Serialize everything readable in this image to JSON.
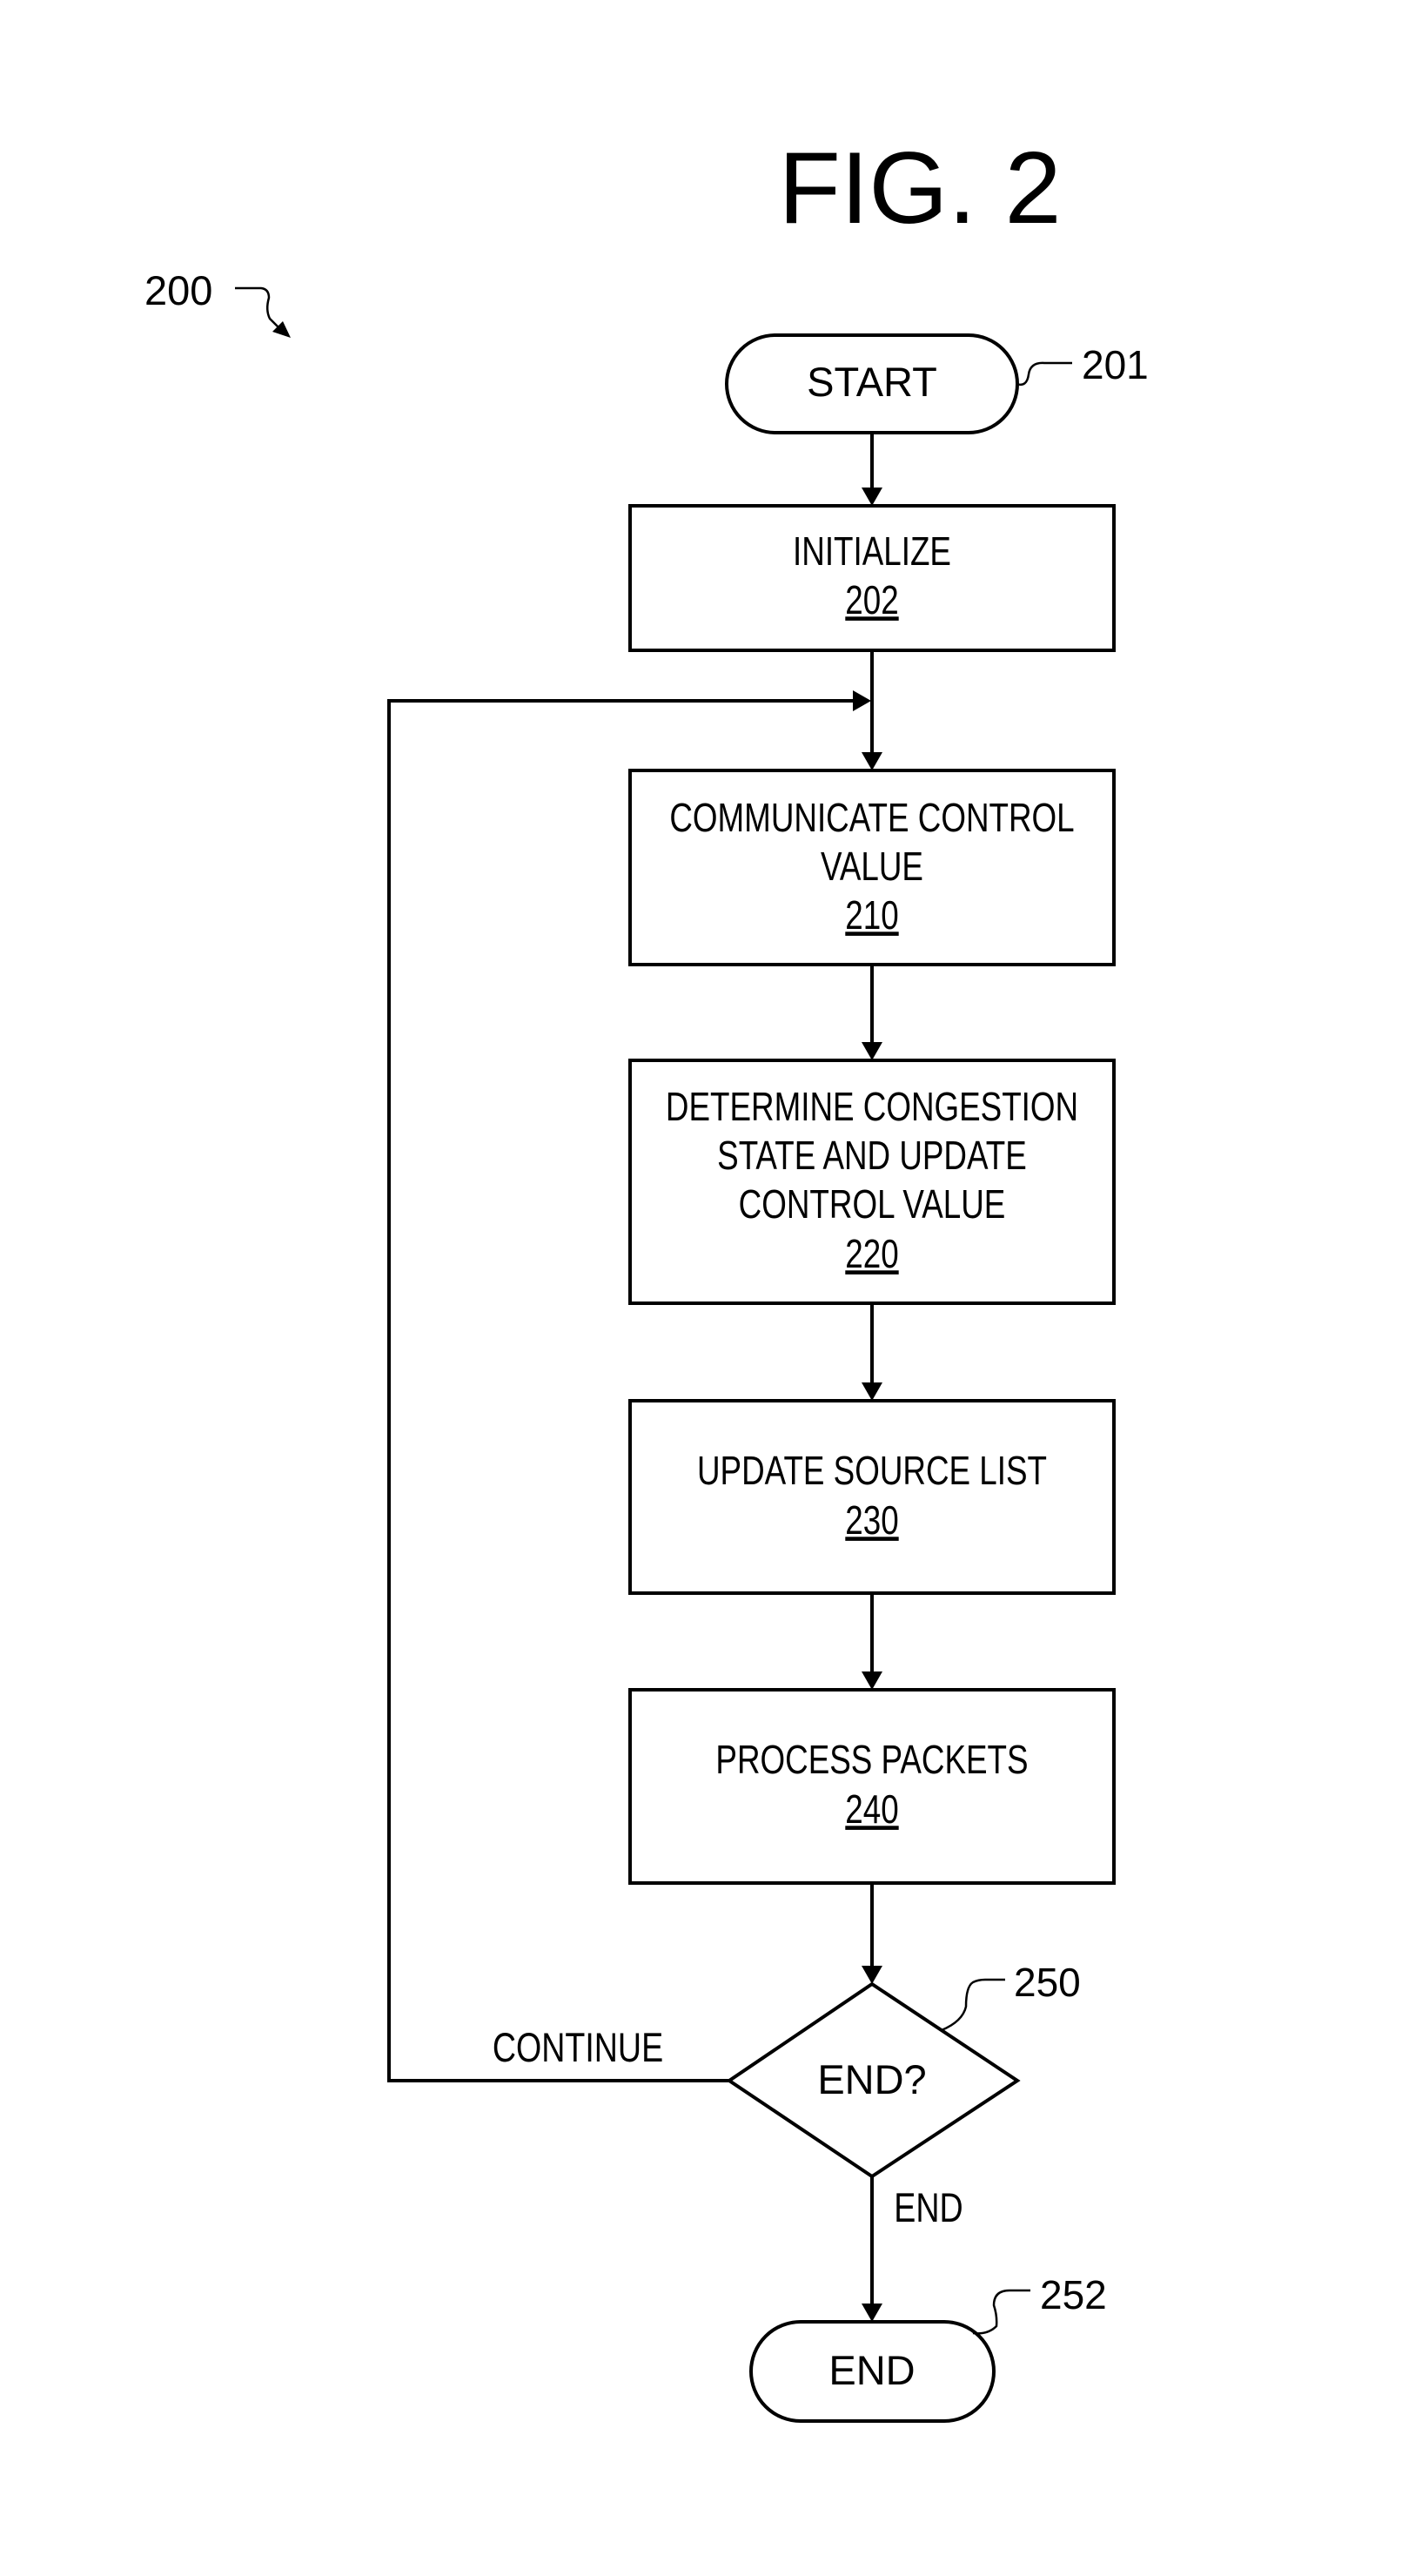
{
  "figure": {
    "title": "FIG. 2",
    "ref": "200"
  },
  "nodes": {
    "start": {
      "type": "terminal",
      "label": "START",
      "ref": "201"
    },
    "initialize": {
      "type": "process",
      "lines": [
        "INITIALIZE"
      ],
      "ref": "202"
    },
    "communicate": {
      "type": "process",
      "lines": [
        "COMMUNICATE CONTROL",
        "VALUE"
      ],
      "ref": "210"
    },
    "determine": {
      "type": "process",
      "lines": [
        "DETERMINE CONGESTION",
        "STATE AND UPDATE",
        "CONTROL VALUE"
      ],
      "ref": "220"
    },
    "update_source": {
      "type": "process",
      "lines": [
        "UPDATE SOURCE LIST"
      ],
      "ref": "230"
    },
    "process_packets": {
      "type": "process",
      "lines": [
        "PROCESS PACKETS"
      ],
      "ref": "240"
    },
    "decision": {
      "type": "decision",
      "label": "END?",
      "ref": "250"
    },
    "end": {
      "type": "terminal",
      "label": "END",
      "ref": "252"
    }
  },
  "edges": {
    "continue_label": "CONTINUE",
    "end_label": "END"
  },
  "flow": [
    [
      "start",
      "initialize"
    ],
    [
      "initialize",
      "communicate"
    ],
    [
      "communicate",
      "determine"
    ],
    [
      "determine",
      "update_source"
    ],
    [
      "update_source",
      "process_packets"
    ],
    [
      "process_packets",
      "decision"
    ],
    [
      "decision",
      "communicate",
      "CONTINUE"
    ],
    [
      "decision",
      "end",
      "END"
    ]
  ]
}
